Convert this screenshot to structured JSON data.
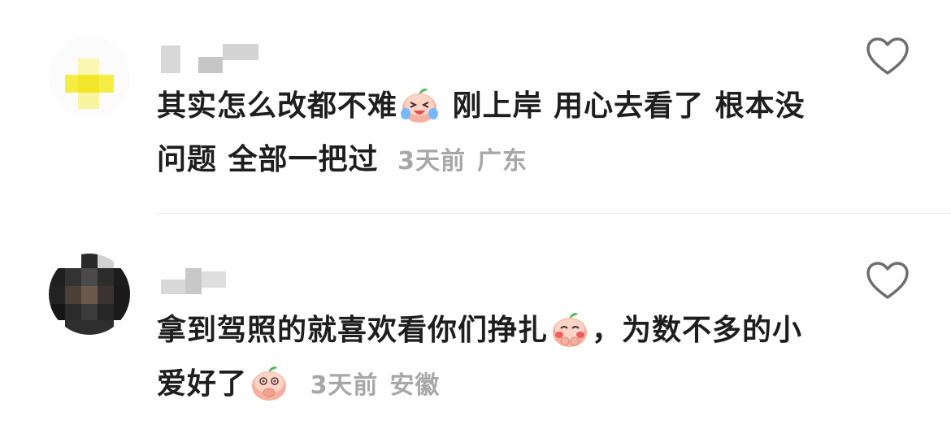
{
  "comments": [
    {
      "text_part1": "其实怎么改都不难",
      "emoji1": "laughing-crying-peach-emoji",
      "text_part2": " 刚上岸 用心去看了 根本没问题 全部一把过",
      "time": "3天前",
      "location": "广东",
      "like_icon": "heart-outline-icon"
    },
    {
      "text_part1": "拿到驾照的就喜欢看你们挣扎",
      "emoji1": "blushing-peach-emoji",
      "text_part2": "，为数不多的小爱好了",
      "emoji2": "covering-mouth-peach-emoji",
      "time": "3天前",
      "location": "安徽",
      "like_icon": "heart-outline-icon"
    }
  ],
  "colors": {
    "text": "#1e1e1e",
    "meta": "#a7a7a7",
    "heart_stroke": "#6e6e6e",
    "divider": "#ececec"
  }
}
